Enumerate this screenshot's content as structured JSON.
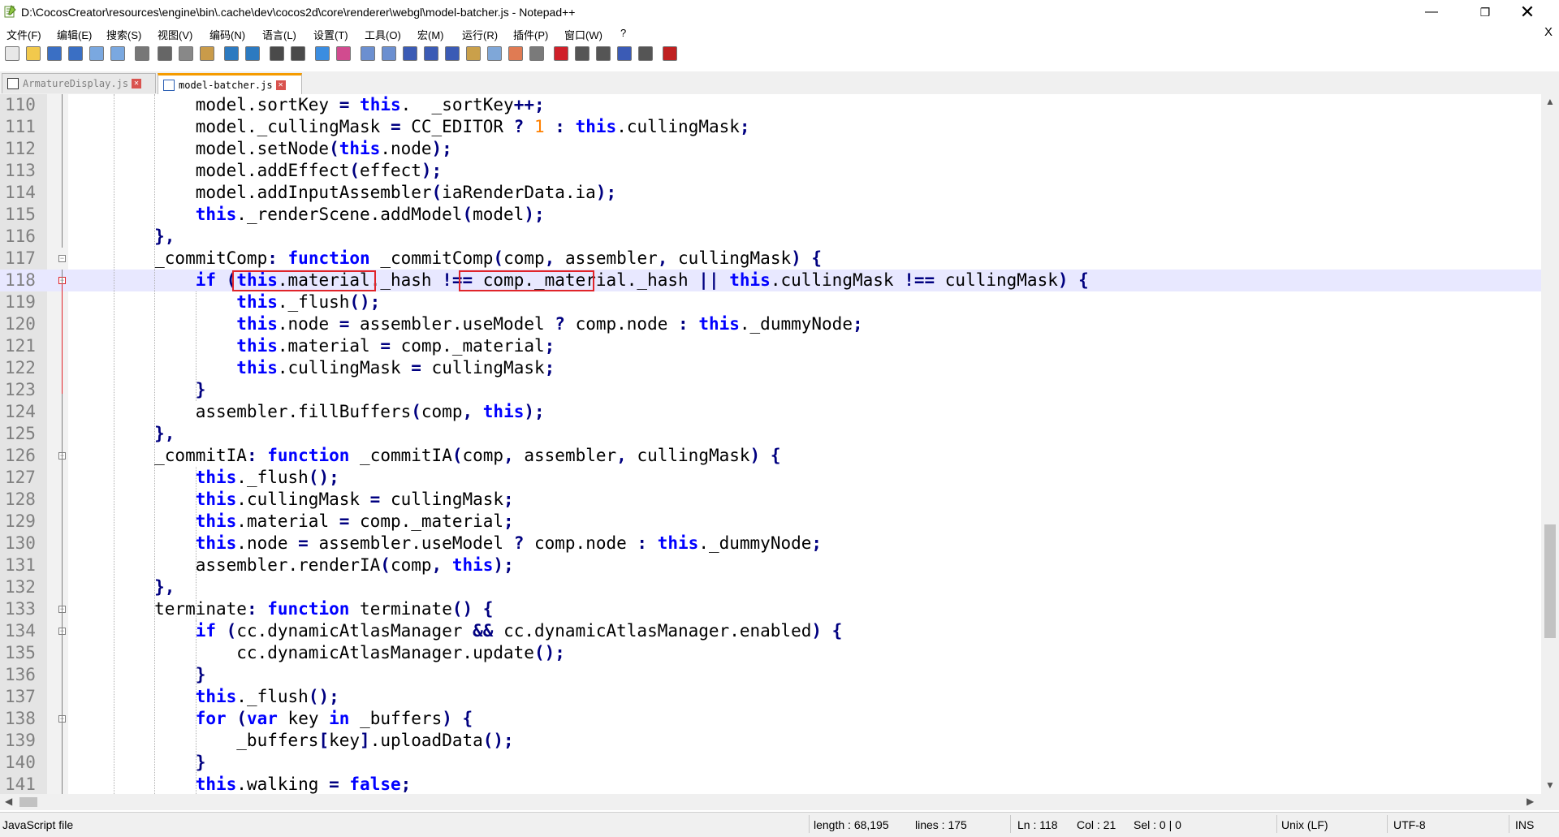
{
  "window": {
    "title": "D:\\CocosCreator\\resources\\engine\\bin\\.cache\\dev\\cocos2d\\core\\renderer\\webgl\\model-batcher.js - Notepad++"
  },
  "menu": [
    "文件(F)",
    "编辑(E)",
    "搜索(S)",
    "视图(V)",
    "编码(N)",
    "语言(L)",
    "设置(T)",
    "工具(O)",
    "宏(M)",
    "运行(R)",
    "插件(P)",
    "窗口(W)",
    "?"
  ],
  "menu_close": "X",
  "toolbar": [
    "new-file-icon",
    "open-file-icon",
    "save-icon",
    "save-all-icon",
    "close-icon",
    "close-all-icon",
    "print-icon",
    "cut-icon",
    "copy-icon",
    "paste-icon",
    "undo-icon",
    "redo-icon",
    "find-icon",
    "replace-icon",
    "zoom-in-icon",
    "zoom-out-icon",
    "sync-v-icon",
    "sync-h-icon",
    "wrap-icon",
    "show-all-chars-icon",
    "indent-guide-icon",
    "doc-map-icon",
    "function-list-icon",
    "folder-as-workspace-icon",
    "monitor-icon",
    "record-macro-icon",
    "stop-macro-icon",
    "play-macro-icon",
    "run-macro-multiple-icon",
    "save-macro-icon",
    "spell-check-icon"
  ],
  "tabs": [
    {
      "label": "ArmatureDisplay.js",
      "active": false
    },
    {
      "label": "model-batcher.js",
      "active": true
    }
  ],
  "editor": {
    "current_line": 118,
    "lines": [
      {
        "n": "110",
        "t": [
          [
            "",
            "            model.sortKey "
          ],
          [
            "op",
            "="
          ],
          [
            "",
            " "
          ],
          [
            "kw",
            "this"
          ],
          [
            "",
            ".  _sortKey"
          ],
          [
            "op",
            "++;"
          ]
        ]
      },
      {
        "n": "111",
        "t": [
          [
            "",
            "            model._cullingMask "
          ],
          [
            "op",
            "="
          ],
          [
            "",
            " CC_EDITOR "
          ],
          [
            "op",
            "?"
          ],
          [
            "",
            " "
          ],
          [
            "num",
            "1"
          ],
          [
            "",
            " "
          ],
          [
            "op",
            ":"
          ],
          [
            "",
            " "
          ],
          [
            "kw",
            "this"
          ],
          [
            "",
            ".cullingMask"
          ],
          [
            "op",
            ";"
          ]
        ]
      },
      {
        "n": "112",
        "t": [
          [
            "",
            "            model.setNode"
          ],
          [
            "op",
            "("
          ],
          [
            "kw",
            "this"
          ],
          [
            "",
            ".node"
          ],
          [
            "op",
            ");"
          ]
        ]
      },
      {
        "n": "113",
        "t": [
          [
            "",
            "            model.addEffect"
          ],
          [
            "op",
            "("
          ],
          [
            "",
            "effect"
          ],
          [
            "op",
            ");"
          ]
        ]
      },
      {
        "n": "114",
        "t": [
          [
            "",
            "            model.addInputAssembler"
          ],
          [
            "op",
            "("
          ],
          [
            "",
            "iaRenderData.ia"
          ],
          [
            "op",
            ");"
          ]
        ]
      },
      {
        "n": "115",
        "t": [
          [
            "",
            "            "
          ],
          [
            "kw",
            "this"
          ],
          [
            "",
            "._renderScene.addModel"
          ],
          [
            "op",
            "("
          ],
          [
            "",
            "model"
          ],
          [
            "op",
            ");"
          ]
        ]
      },
      {
        "n": "116",
        "t": [
          [
            "",
            "        "
          ],
          [
            "op",
            "},"
          ]
        ]
      },
      {
        "n": "117",
        "t": [
          [
            "",
            "        _commitComp"
          ],
          [
            "op",
            ":"
          ],
          [
            "",
            " "
          ],
          [
            "kw",
            "function"
          ],
          [
            "",
            " _commitComp"
          ],
          [
            "op",
            "("
          ],
          [
            "",
            "comp"
          ],
          [
            "op",
            ","
          ],
          [
            "",
            " assembler"
          ],
          [
            "op",
            ","
          ],
          [
            "",
            " cullingMask"
          ],
          [
            "op",
            ")"
          ],
          [
            "",
            " "
          ],
          [
            "op",
            "{"
          ]
        ]
      },
      {
        "n": "118",
        "t": [
          [
            "",
            "            "
          ],
          [
            "kw",
            "if"
          ],
          [
            "",
            " "
          ],
          [
            "op",
            "("
          ],
          [
            "kw",
            "this"
          ],
          [
            "",
            ".material._hash "
          ],
          [
            "op",
            "!=="
          ],
          [
            "",
            " comp._material._hash "
          ],
          [
            "op",
            "||"
          ],
          [
            "",
            " "
          ],
          [
            "kw",
            "this"
          ],
          [
            "",
            ".cullingMask "
          ],
          [
            "op",
            "!=="
          ],
          [
            "",
            " cullingMask"
          ],
          [
            "op",
            ")"
          ],
          [
            "",
            " "
          ],
          [
            "op",
            "{"
          ]
        ]
      },
      {
        "n": "119",
        "t": [
          [
            "",
            "                "
          ],
          [
            "kw",
            "this"
          ],
          [
            "",
            "._flush"
          ],
          [
            "op",
            "();"
          ]
        ]
      },
      {
        "n": "120",
        "t": [
          [
            "",
            "                "
          ],
          [
            "kw",
            "this"
          ],
          [
            "",
            ".node "
          ],
          [
            "op",
            "="
          ],
          [
            "",
            " assembler.useModel "
          ],
          [
            "op",
            "?"
          ],
          [
            "",
            " comp.node "
          ],
          [
            "op",
            ":"
          ],
          [
            "",
            " "
          ],
          [
            "kw",
            "this"
          ],
          [
            "",
            "._dummyNode"
          ],
          [
            "op",
            ";"
          ]
        ]
      },
      {
        "n": "121",
        "t": [
          [
            "",
            "                "
          ],
          [
            "kw",
            "this"
          ],
          [
            "",
            ".material "
          ],
          [
            "op",
            "="
          ],
          [
            "",
            " comp._material"
          ],
          [
            "op",
            ";"
          ]
        ]
      },
      {
        "n": "122",
        "t": [
          [
            "",
            "                "
          ],
          [
            "kw",
            "this"
          ],
          [
            "",
            ".cullingMask "
          ],
          [
            "op",
            "="
          ],
          [
            "",
            " cullingMask"
          ],
          [
            "op",
            ";"
          ]
        ]
      },
      {
        "n": "123",
        "t": [
          [
            "",
            "            "
          ],
          [
            "op",
            "}"
          ]
        ]
      },
      {
        "n": "124",
        "t": [
          [
            "",
            "            assembler.fillBuffers"
          ],
          [
            "op",
            "("
          ],
          [
            "",
            "comp"
          ],
          [
            "op",
            ","
          ],
          [
            "",
            " "
          ],
          [
            "kw",
            "this"
          ],
          [
            "op",
            ");"
          ]
        ]
      },
      {
        "n": "125",
        "t": [
          [
            "",
            "        "
          ],
          [
            "op",
            "},"
          ]
        ]
      },
      {
        "n": "126",
        "t": [
          [
            "",
            "        _commitIA"
          ],
          [
            "op",
            ":"
          ],
          [
            "",
            " "
          ],
          [
            "kw",
            "function"
          ],
          [
            "",
            " _commitIA"
          ],
          [
            "op",
            "("
          ],
          [
            "",
            "comp"
          ],
          [
            "op",
            ","
          ],
          [
            "",
            " assembler"
          ],
          [
            "op",
            ","
          ],
          [
            "",
            " cullingMask"
          ],
          [
            "op",
            ")"
          ],
          [
            "",
            " "
          ],
          [
            "op",
            "{"
          ]
        ]
      },
      {
        "n": "127",
        "t": [
          [
            "",
            "            "
          ],
          [
            "kw",
            "this"
          ],
          [
            "",
            "._flush"
          ],
          [
            "op",
            "();"
          ]
        ]
      },
      {
        "n": "128",
        "t": [
          [
            "",
            "            "
          ],
          [
            "kw",
            "this"
          ],
          [
            "",
            ".cullingMask "
          ],
          [
            "op",
            "="
          ],
          [
            "",
            " cullingMask"
          ],
          [
            "op",
            ";"
          ]
        ]
      },
      {
        "n": "129",
        "t": [
          [
            "",
            "            "
          ],
          [
            "kw",
            "this"
          ],
          [
            "",
            ".material "
          ],
          [
            "op",
            "="
          ],
          [
            "",
            " comp._material"
          ],
          [
            "op",
            ";"
          ]
        ]
      },
      {
        "n": "130",
        "t": [
          [
            "",
            "            "
          ],
          [
            "kw",
            "this"
          ],
          [
            "",
            ".node "
          ],
          [
            "op",
            "="
          ],
          [
            "",
            " assembler.useModel "
          ],
          [
            "op",
            "?"
          ],
          [
            "",
            " comp.node "
          ],
          [
            "op",
            ":"
          ],
          [
            "",
            " "
          ],
          [
            "kw",
            "this"
          ],
          [
            "",
            "._dummyNode"
          ],
          [
            "op",
            ";"
          ]
        ]
      },
      {
        "n": "131",
        "t": [
          [
            "",
            "            assembler.renderIA"
          ],
          [
            "op",
            "("
          ],
          [
            "",
            "comp"
          ],
          [
            "op",
            ","
          ],
          [
            "",
            " "
          ],
          [
            "kw",
            "this"
          ],
          [
            "op",
            ");"
          ]
        ]
      },
      {
        "n": "132",
        "t": [
          [
            "",
            "        "
          ],
          [
            "op",
            "},"
          ]
        ]
      },
      {
        "n": "133",
        "t": [
          [
            "",
            "        terminate"
          ],
          [
            "op",
            ":"
          ],
          [
            "",
            " "
          ],
          [
            "kw",
            "function"
          ],
          [
            "",
            " terminate"
          ],
          [
            "op",
            "()"
          ],
          [
            "",
            " "
          ],
          [
            "op",
            "{"
          ]
        ]
      },
      {
        "n": "134",
        "t": [
          [
            "",
            "            "
          ],
          [
            "kw",
            "if"
          ],
          [
            "",
            " "
          ],
          [
            "op",
            "("
          ],
          [
            "",
            "cc.dynamicAtlasManager "
          ],
          [
            "op",
            "&&"
          ],
          [
            "",
            " cc.dynamicAtlasManager.enabled"
          ],
          [
            "op",
            ")"
          ],
          [
            "",
            " "
          ],
          [
            "op",
            "{"
          ]
        ]
      },
      {
        "n": "135",
        "t": [
          [
            "",
            "                cc.dynamicAtlasManager.update"
          ],
          [
            "op",
            "();"
          ]
        ]
      },
      {
        "n": "136",
        "t": [
          [
            "",
            "            "
          ],
          [
            "op",
            "}"
          ]
        ]
      },
      {
        "n": "137",
        "t": [
          [
            "",
            "            "
          ],
          [
            "kw",
            "this"
          ],
          [
            "",
            "._flush"
          ],
          [
            "op",
            "();"
          ]
        ]
      },
      {
        "n": "138",
        "t": [
          [
            "",
            "            "
          ],
          [
            "kw",
            "for"
          ],
          [
            "",
            " "
          ],
          [
            "op",
            "("
          ],
          [
            "kw",
            "var"
          ],
          [
            "",
            " key "
          ],
          [
            "kw",
            "in"
          ],
          [
            "",
            " _buffers"
          ],
          [
            "op",
            ")"
          ],
          [
            "",
            " "
          ],
          [
            "op",
            "{"
          ]
        ]
      },
      {
        "n": "139",
        "t": [
          [
            "",
            "                _buffers"
          ],
          [
            "op",
            "["
          ],
          [
            "",
            "key"
          ],
          [
            "op",
            "]"
          ],
          [
            "",
            ".uploadData"
          ],
          [
            "op",
            "();"
          ]
        ]
      },
      {
        "n": "140",
        "t": [
          [
            "",
            "            "
          ],
          [
            "op",
            "}"
          ]
        ]
      },
      {
        "n": "141",
        "t": [
          [
            "",
            "            "
          ],
          [
            "kw",
            "this"
          ],
          [
            "",
            ".walking "
          ],
          [
            "op",
            "="
          ],
          [
            "",
            " "
          ],
          [
            "kw",
            "false"
          ],
          [
            "op",
            ";"
          ]
        ]
      }
    ]
  },
  "status": {
    "file_type": "JavaScript file",
    "length": "length : 68,195",
    "lines": "lines : 175",
    "ln": "Ln : 118",
    "col": "Col : 21",
    "sel": "Sel : 0 | 0",
    "eol": "Unix (LF)",
    "encoding": "UTF-8",
    "mode": "INS"
  },
  "colors": {
    "keyword": "#0000ff",
    "operator": "#000080",
    "number": "#ff8000",
    "highlight_box": "#e0242a",
    "active_tab_accent": "#f59b00",
    "current_line": "#e8e8ff"
  }
}
